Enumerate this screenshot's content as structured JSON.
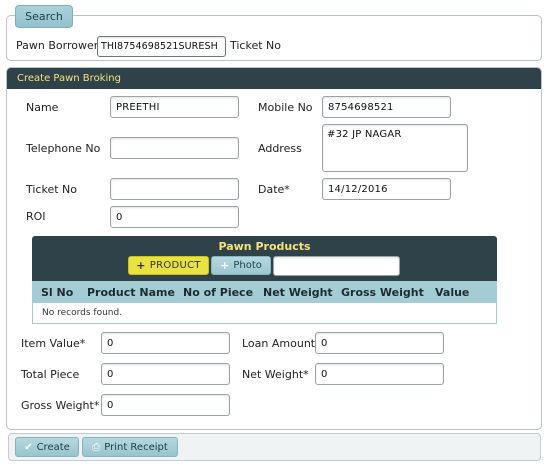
{
  "search": {
    "tab_label": "Search",
    "borrower_label": "Pawn Borrower",
    "borrower_value": "THI8754698521SURESH",
    "ticket_label": "Ticket No"
  },
  "create": {
    "header": "Create Pawn Broking",
    "name_label": "Name",
    "name_value": "PREETHI",
    "mobile_label": "Mobile No",
    "mobile_value": "8754698521",
    "telephone_label": "Telephone No",
    "telephone_value": "",
    "address_label": "Address",
    "address_value": "#32 JP NAGAR",
    "ticket_label": "Ticket No",
    "ticket_value": "",
    "date_label": "Date*",
    "date_value": "14/12/2016",
    "roi_label": "ROI",
    "roi_value": "0"
  },
  "products": {
    "title": "Pawn Products",
    "product_button": "PRODUCT",
    "photo_button": "Photo",
    "photo_value": "",
    "columns": [
      "Sl No",
      "Product Name",
      "No of Piece",
      "Net Weight",
      "Gross Weight",
      "Value"
    ],
    "empty_text": "No records found."
  },
  "valuation": {
    "item_value_label": "Item Value*",
    "item_value": "0",
    "loan_amount_label": "Loan Amount",
    "loan_amount": "0",
    "total_piece_label": "Total Piece",
    "total_piece": "0",
    "net_weight_label": "Net Weight*",
    "net_weight": "0",
    "gross_weight_label": "Gross Weight*",
    "gross_weight": "0"
  },
  "actions": {
    "create_label": "Create",
    "print_label": "Print Receipt"
  },
  "colors": {
    "header_bg": "#2f4249",
    "header_text": "#f4e27a",
    "column_header_bg": "#a4ccd4",
    "product_button_bg": "#e9e23f"
  }
}
